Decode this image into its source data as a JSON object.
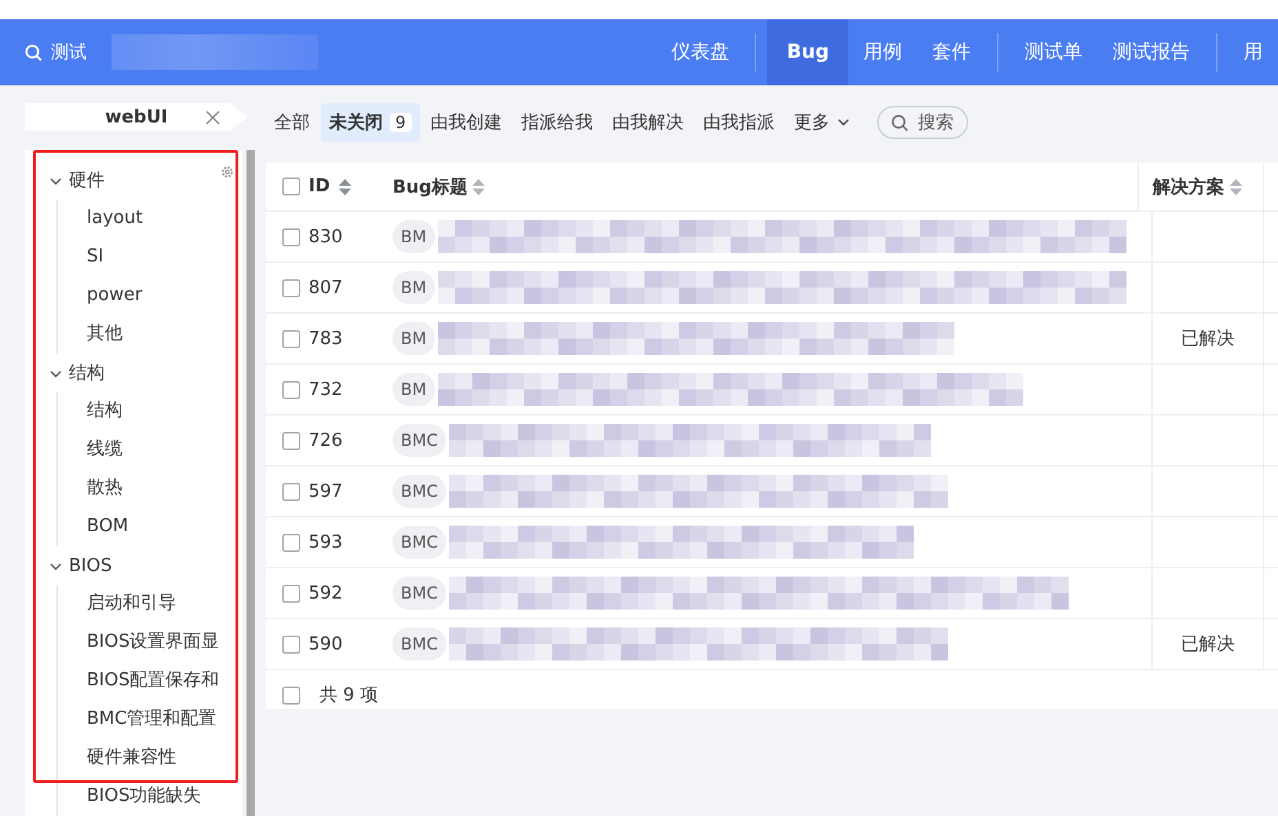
{
  "header": {
    "search_label": "测试",
    "product_redacted": true,
    "nav_groups": [
      [
        {
          "label": "仪表盘",
          "selected": false
        }
      ],
      [
        {
          "label": "Bug",
          "selected": true
        },
        {
          "label": "用例",
          "selected": false
        },
        {
          "label": "套件",
          "selected": false
        }
      ],
      [
        {
          "label": "测试单",
          "selected": false
        },
        {
          "label": "测试报告",
          "selected": false
        }
      ],
      [
        {
          "label": "用",
          "selected": false
        }
      ]
    ]
  },
  "module_tab": {
    "label": "webUI"
  },
  "filters": [
    {
      "label": "全部",
      "selected": false
    },
    {
      "label": "未关闭",
      "selected": true,
      "count": "9"
    },
    {
      "label": "由我创建",
      "selected": false
    },
    {
      "label": "指派给我",
      "selected": false
    },
    {
      "label": "由我解决",
      "selected": false
    },
    {
      "label": "由我指派",
      "selected": false
    },
    {
      "label": "更多",
      "selected": false,
      "kind": "dropdown"
    }
  ],
  "search": {
    "label": "搜索"
  },
  "tree": [
    {
      "label": "硬件",
      "expanded": true,
      "children": [
        {
          "label": "layout"
        },
        {
          "label": "SI"
        },
        {
          "label": "power"
        },
        {
          "label": "其他"
        }
      ]
    },
    {
      "label": "结构",
      "expanded": true,
      "children": [
        {
          "label": "结构"
        },
        {
          "label": "线缆"
        },
        {
          "label": "散热"
        },
        {
          "label": "BOM"
        }
      ]
    },
    {
      "label": "BIOS",
      "expanded": true,
      "children": [
        {
          "label": "启动和引导"
        },
        {
          "label": "BIOS设置界面显"
        },
        {
          "label": "BIOS配置保存和"
        },
        {
          "label": "BMC管理和配置"
        },
        {
          "label": "硬件兼容性"
        },
        {
          "label": "BIOS功能缺失"
        }
      ]
    }
  ],
  "table": {
    "columns": [
      "ID",
      "Bug标题",
      "解决方案"
    ],
    "rows": [
      {
        "id": "830",
        "tag": "BM",
        "title_redacted": true,
        "checked": false
      },
      {
        "id": "807",
        "tag": "BM",
        "title_redacted": true,
        "checked": false
      },
      {
        "id": "783",
        "tag": "BM",
        "title_redacted": true,
        "resolution": "已解决",
        "checked": false
      },
      {
        "id": "732",
        "tag": "BM",
        "title_redacted": true,
        "checked": false
      },
      {
        "id": "726",
        "tag": "BMC",
        "title_redacted": true,
        "checked": false
      },
      {
        "id": "597",
        "tag": "BMC",
        "title_redacted": true,
        "checked": false
      },
      {
        "id": "593",
        "tag": "BMC",
        "title_redacted": true,
        "checked": false
      },
      {
        "id": "592",
        "tag": "BMC",
        "title_redacted": true,
        "checked": false
      },
      {
        "id": "590",
        "tag": "BMC",
        "title_redacted": true,
        "resolution": "已解决",
        "checked": false
      }
    ],
    "footer": "共 9 项",
    "footer_checked": false,
    "select_all_checked": false
  },
  "annotation": {
    "highlight": true
  }
}
